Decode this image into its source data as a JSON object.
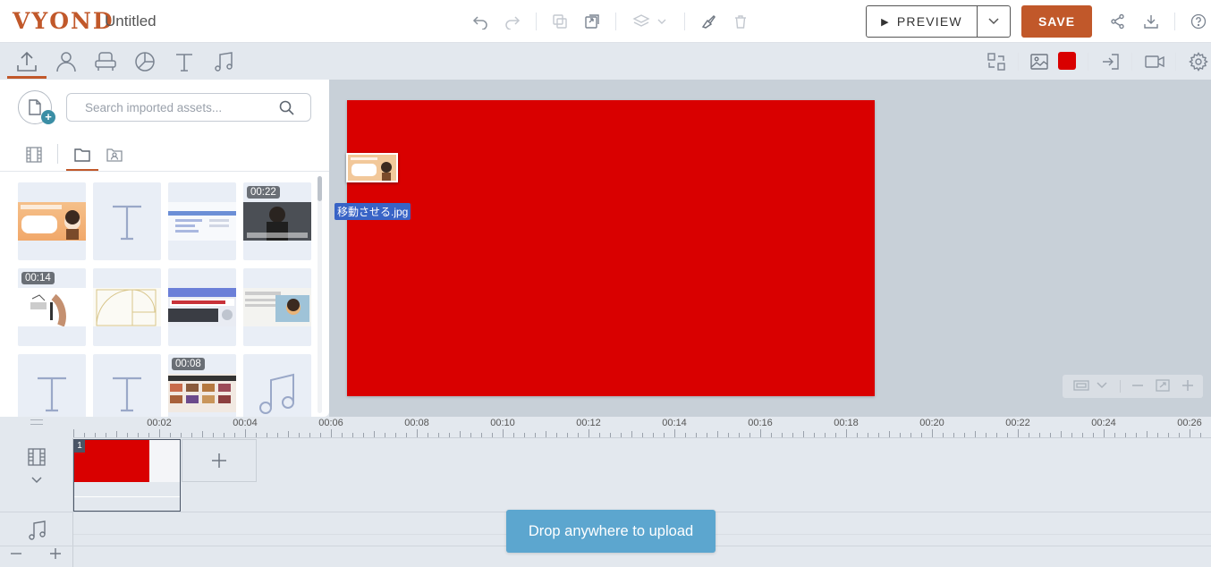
{
  "app": {
    "logo": "VYOND",
    "title": "Untitled"
  },
  "header": {
    "preview_label": "PREVIEW",
    "save_label": "SAVE"
  },
  "toolbar": {
    "fill_color": "#d90000",
    "brand_color": "#c1582a"
  },
  "library": {
    "search_placeholder": "Search imported assets...",
    "assets": [
      {
        "kind": "image",
        "duration": ""
      },
      {
        "kind": "text",
        "duration": ""
      },
      {
        "kind": "image",
        "duration": ""
      },
      {
        "kind": "video",
        "duration": "00:22"
      },
      {
        "kind": "video",
        "duration": "00:14"
      },
      {
        "kind": "image",
        "duration": ""
      },
      {
        "kind": "image",
        "duration": ""
      },
      {
        "kind": "image",
        "duration": ""
      },
      {
        "kind": "text",
        "duration": ""
      },
      {
        "kind": "text",
        "duration": ""
      },
      {
        "kind": "video",
        "duration": "00:08"
      },
      {
        "kind": "audio",
        "duration": ""
      }
    ]
  },
  "canvas": {
    "background_color": "#d90000",
    "dragging_file": "移動させる.jpg"
  },
  "timeline": {
    "ruler": [
      "00:02",
      "00:04",
      "00:06",
      "00:08",
      "00:10",
      "00:12",
      "00:14",
      "00:16",
      "00:18",
      "00:20",
      "00:22",
      "00:24",
      "00:26"
    ],
    "scene_number": "1"
  },
  "toast": {
    "message": "Drop anywhere to upload"
  }
}
